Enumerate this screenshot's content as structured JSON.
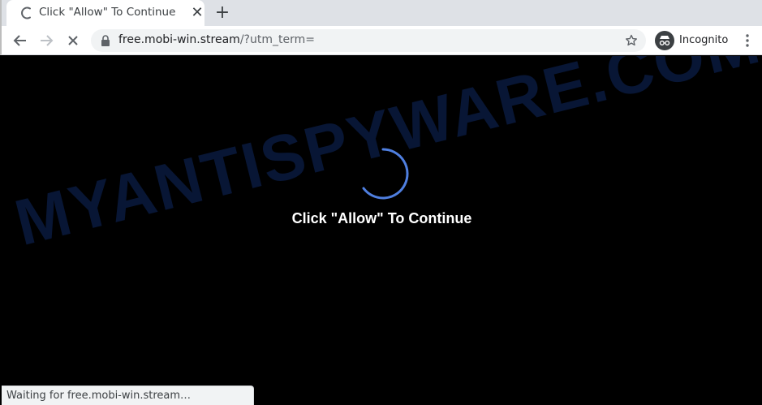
{
  "tab": {
    "title": "Click \"Allow\" To Continue",
    "close_glyph": "✕",
    "new_tab_glyph": "+"
  },
  "toolbar": {
    "url_host": "free.mobi-win.stream",
    "url_path": "/?utm_term=",
    "incognito_label": "Incognito"
  },
  "page": {
    "watermark": "MYANTISPYWARE.COM",
    "message": "Click \"Allow\" To Continue"
  },
  "status_bar": {
    "text": "Waiting for free.mobi-win.stream…"
  },
  "colors": {
    "page_background": "#000000",
    "spinner": "#4f7fe0",
    "watermark": "#0a1a3f"
  }
}
